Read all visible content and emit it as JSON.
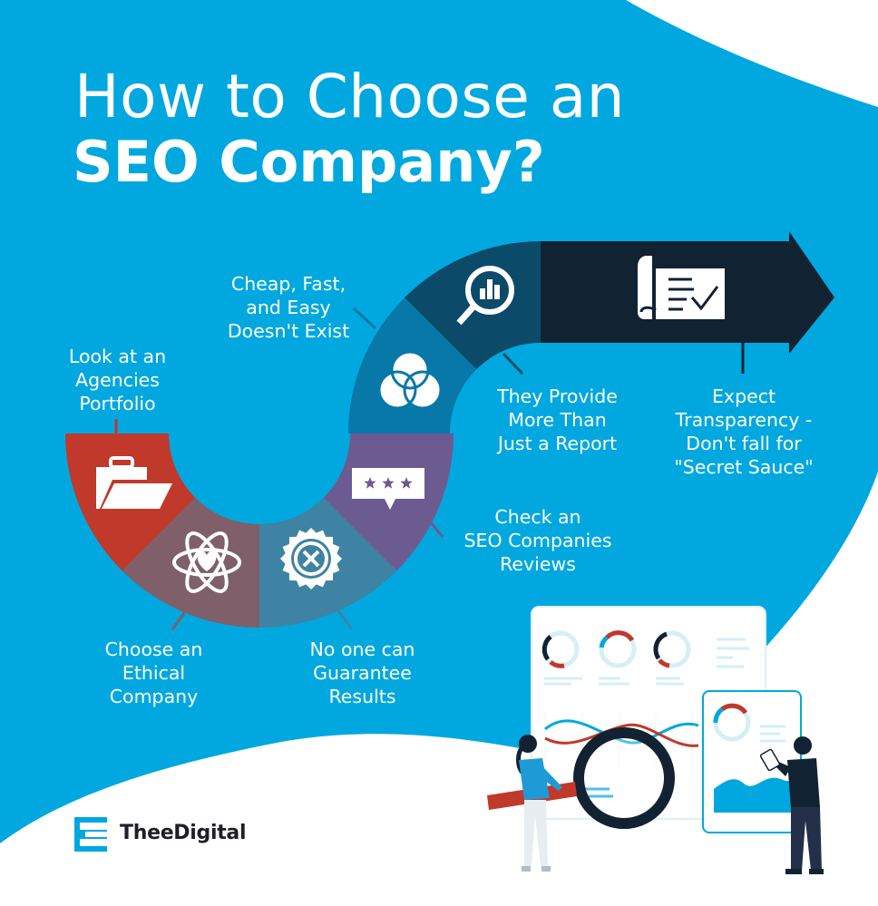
{
  "title": {
    "line1": "How to Choose an",
    "line2": "SEO Company?"
  },
  "steps": [
    {
      "label_lines": [
        "Look at an",
        "Agencies",
        "Portfolio"
      ],
      "icon": "folder-icon",
      "color": "#c0392b"
    },
    {
      "label_lines": [
        "Choose an",
        "Ethical",
        "Company"
      ],
      "icon": "atom-heart-icon",
      "color": "#7e5f6a"
    },
    {
      "label_lines": [
        "No one can",
        "Guarantee",
        "Results"
      ],
      "icon": "badge-x-icon",
      "color": "#3e83a3"
    },
    {
      "label_lines": [
        "Check an",
        "SEO Companies",
        "Reviews"
      ],
      "icon": "review-stars-icon",
      "color": "#6c5b91"
    },
    {
      "label_lines": [
        "Cheap, Fast,",
        "and Easy",
        "Doesn't Exist"
      ],
      "icon": "venn-diagram-icon",
      "color": "#0878a8"
    },
    {
      "label_lines": [
        "They Provide",
        "More Than",
        "Just a Report"
      ],
      "icon": "magnifier-chart-icon",
      "color": "#0c4a6a"
    },
    {
      "label_lines": [
        "Expect",
        "Transparency -",
        "Don't fall for",
        "\"Secret Sauce\""
      ],
      "icon": "document-check-icon",
      "color": "#112233"
    }
  ],
  "colors": {
    "background_blue": "#00a8df",
    "white": "#ffffff",
    "dark_navy": "#112233"
  },
  "brand": {
    "name": "TheeDigital",
    "logo_icon": "e-logo-icon",
    "logo_color": "#00a8df"
  },
  "illustration": {
    "subject": "two people analyzing dashboard charts with a magnifying glass"
  }
}
